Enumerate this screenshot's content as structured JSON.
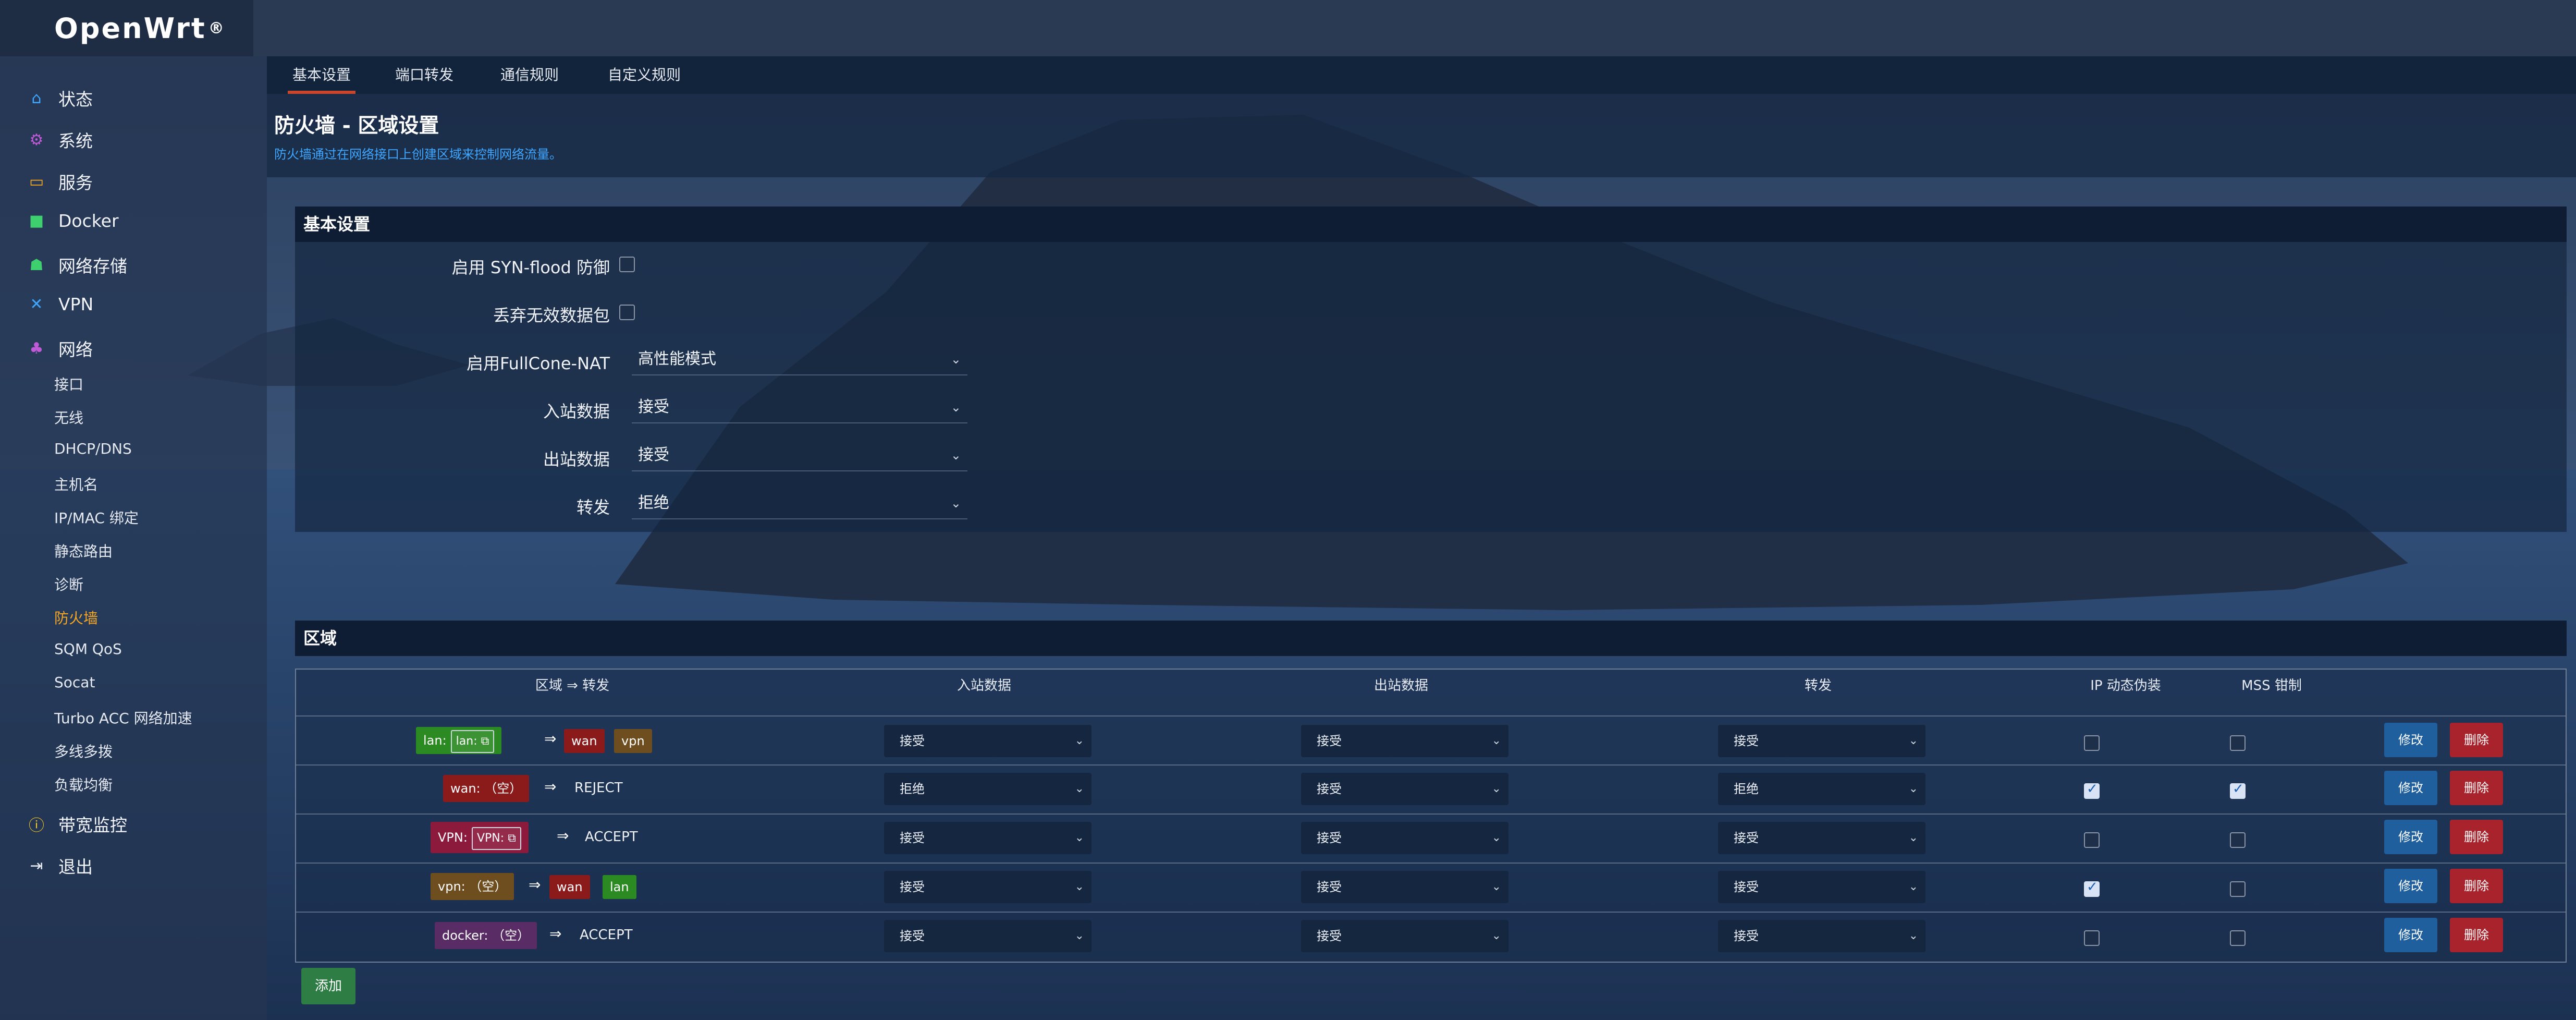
{
  "brand": {
    "name": "OpenWrt",
    "mark": "®"
  },
  "sidebar": {
    "items": [
      {
        "label": "状态",
        "icon": "home-icon"
      },
      {
        "label": "系统",
        "icon": "gear-icon"
      },
      {
        "label": "服务",
        "icon": "service-icon"
      },
      {
        "label": "Docker",
        "icon": "docker-icon"
      },
      {
        "label": "网络存储",
        "icon": "storage-icon"
      },
      {
        "label": "VPN",
        "icon": "vpn-icon"
      },
      {
        "label": "网络",
        "icon": "network-icon"
      }
    ],
    "network_sub": [
      {
        "label": "接口"
      },
      {
        "label": "无线"
      },
      {
        "label": "DHCP/DNS"
      },
      {
        "label": "主机名"
      },
      {
        "label": "IP/MAC 绑定"
      },
      {
        "label": "静态路由"
      },
      {
        "label": "诊断"
      },
      {
        "label": "防火墙",
        "active": true
      },
      {
        "label": "SQM QoS"
      },
      {
        "label": "Socat"
      },
      {
        "label": "Turbo ACC 网络加速"
      },
      {
        "label": "多线多拨"
      },
      {
        "label": "负载均衡"
      }
    ],
    "bottom": [
      {
        "label": "带宽监控",
        "icon": "bandwidth-icon"
      },
      {
        "label": "退出",
        "icon": "logout-icon"
      }
    ]
  },
  "tabs": [
    {
      "label": "基本设置",
      "active": true
    },
    {
      "label": "端口转发"
    },
    {
      "label": "通信规则"
    },
    {
      "label": "自定义规则"
    }
  ],
  "page": {
    "title": "防火墙 - 区域设置",
    "description": "防火墙通过在网络接口上创建区域来控制网络流量。"
  },
  "basic": {
    "heading": "基本设置",
    "syn_flood": {
      "label": "启用 SYN-flood 防御",
      "checked": false
    },
    "drop_invalid": {
      "label": "丢弃无效数据包",
      "checked": false
    },
    "fullcone": {
      "label": "启用FullCone-NAT",
      "value": "高性能模式"
    },
    "input": {
      "label": "入站数据",
      "value": "接受"
    },
    "output": {
      "label": "出站数据",
      "value": "接受"
    },
    "forward": {
      "label": "转发",
      "value": "拒绝"
    }
  },
  "zones": {
    "heading": "区域",
    "columns": {
      "zone_forward": "区域 ⇒ 转发",
      "input": "入站数据",
      "output": "出站数据",
      "forward": "转发",
      "masq": "IP 动态伪装",
      "mss": "MSS 钳制"
    },
    "arrow": "⇒",
    "rows": [
      {
        "zone": "lan:",
        "zone_inner": "lan:",
        "targets": [
          "wan",
          "vpn"
        ],
        "input": "接受",
        "output": "接受",
        "forward": "接受",
        "masq": false,
        "mss": false
      },
      {
        "zone": "wan: （空）",
        "policy": "REJECT",
        "input": "拒绝",
        "output": "接受",
        "forward": "拒绝",
        "masq": true,
        "mss": true
      },
      {
        "zone": "VPN:",
        "zone_inner": "VPN:",
        "policy": "ACCEPT",
        "input": "接受",
        "output": "接受",
        "forward": "接受",
        "masq": false,
        "mss": false
      },
      {
        "zone": "vpn: （空）",
        "targets": [
          "wan",
          "lan"
        ],
        "input": "接受",
        "output": "接受",
        "forward": "接受",
        "masq": true,
        "mss": false
      },
      {
        "zone": "docker: （空）",
        "policy": "ACCEPT",
        "input": "接受",
        "output": "接受",
        "forward": "接受",
        "masq": false,
        "mss": false
      }
    ],
    "edit_label": "修改",
    "delete_label": "删除",
    "add_label": "添加"
  },
  "colors": {
    "lan": "#2b8a22",
    "wan": "#8b1a1a",
    "vpn_lower": "#6e4e1e",
    "VPN_upper": "#8b1a3c",
    "docker": "#5a2c66",
    "accent": "#f5a623"
  }
}
